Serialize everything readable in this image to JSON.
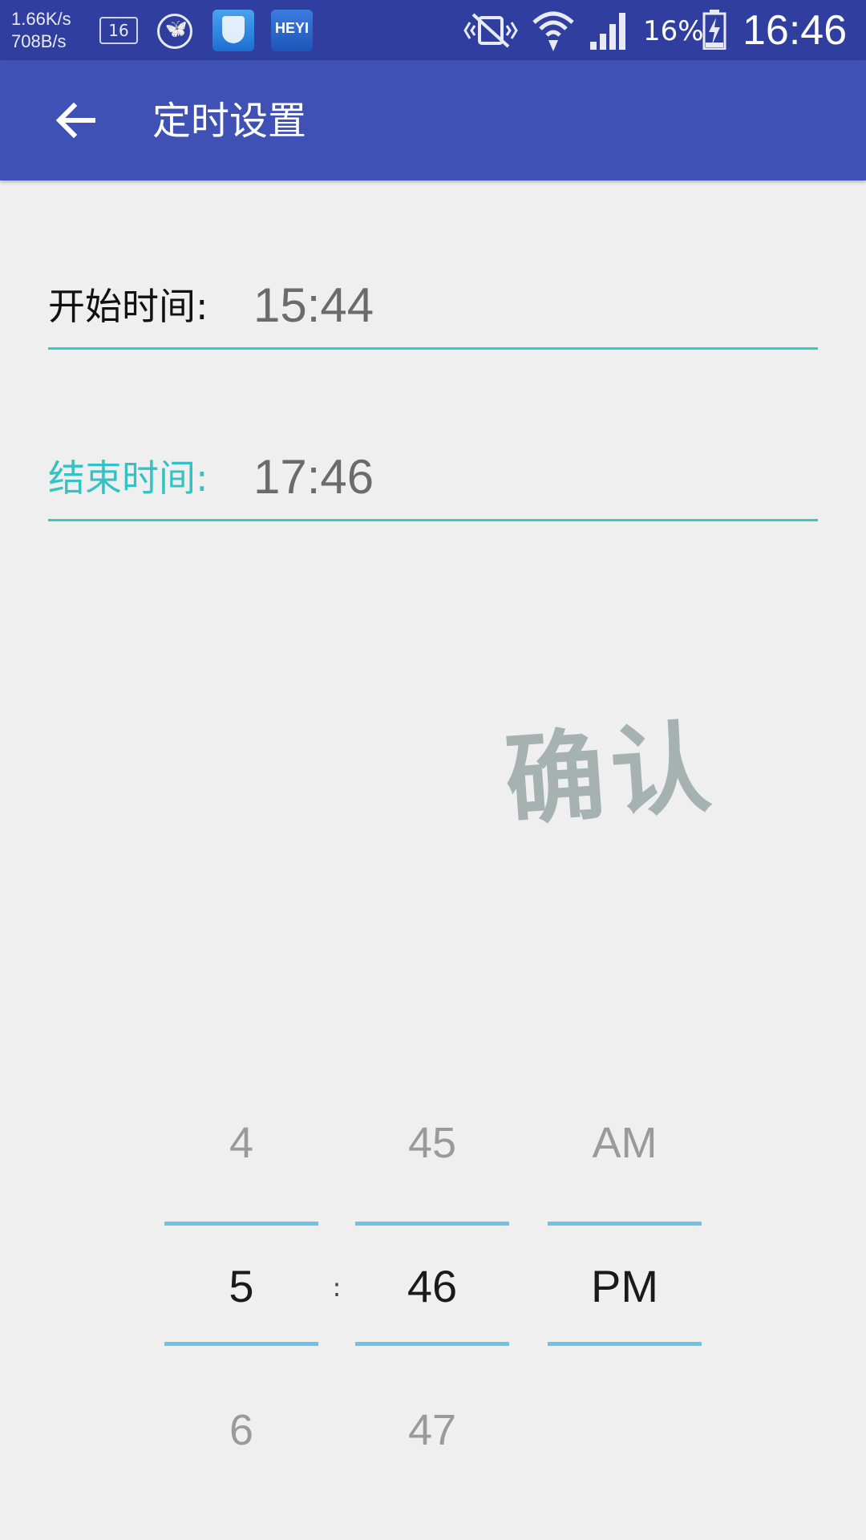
{
  "status_bar": {
    "net_speed_up": "1.66K/s",
    "net_speed_down": "708B/s",
    "sim_badge": "16",
    "app_icon_heyi_text": "HEYI",
    "battery_percent": "16%",
    "battery_level": 0.16,
    "time": "16:46"
  },
  "toolbar": {
    "back_icon": "arrow-back-icon",
    "title": "定时设置"
  },
  "schedule": {
    "start_label": "开始时间:",
    "start_value": "15:44",
    "end_label": "结束时间:",
    "end_value": "17:46"
  },
  "confirm_label": "确认",
  "time_picker": {
    "hour": {
      "prev": "4",
      "current": "5",
      "next": "6"
    },
    "separator": ":",
    "minute": {
      "prev": "45",
      "current": "46",
      "next": "47"
    },
    "ampm": {
      "prev": "AM",
      "current": "PM",
      "next": ""
    }
  },
  "colors": {
    "status_bar": "#303f9f",
    "toolbar": "#3f51b5",
    "accent_teal": "#34c2c2",
    "picker_line": "#6ec2e8",
    "background": "#efefef"
  }
}
